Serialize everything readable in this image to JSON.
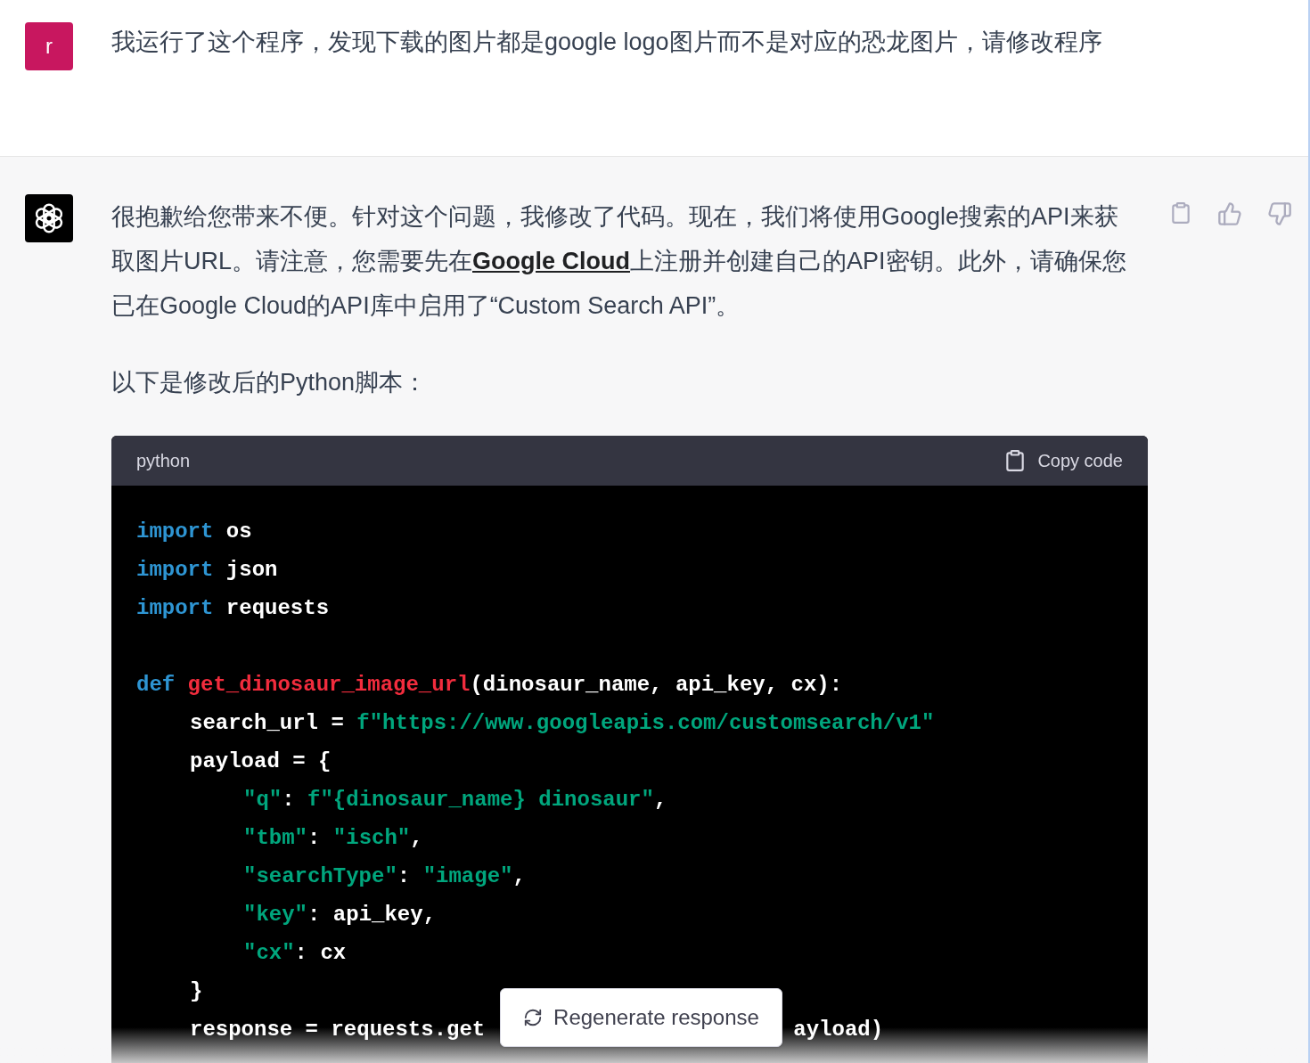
{
  "user_message": {
    "avatar": "r",
    "text": "我运行了这个程序，发现下载的图片都是google logo图片而不是对应的恐龙图片，请修改程序"
  },
  "assistant_message": {
    "paragraphs": [
      {
        "parts": [
          {
            "kind": "text",
            "text": "很抱歉给您带来不便。针对这个问题，我修改了代码。现在，我们将使用Google搜索的API来获取图片URL。请注意，您需要先在"
          },
          {
            "kind": "link",
            "text": "Google Cloud"
          },
          {
            "kind": "text",
            "text": "上注册并创建自己的API密钥。此外，请确保您已在Google Cloud的API库中启用了“Custom Search API”。"
          }
        ]
      },
      {
        "parts": [
          {
            "kind": "text",
            "text": "以下是修改后的Python脚本："
          }
        ]
      }
    ],
    "code_block": {
      "language": "python",
      "copy_label": "Copy code",
      "lines": [
        {
          "segments": [
            [
              {
                "kind": "keyword",
                "text": "import"
              },
              {
                "kind": "plain",
                "text": " os"
              }
            ]
          ]
        },
        {
          "segments": [
            [
              {
                "kind": "keyword",
                "text": "import"
              },
              {
                "kind": "plain",
                "text": " json"
              }
            ]
          ]
        },
        {
          "segments": [
            [
              {
                "kind": "keyword",
                "text": "import"
              },
              {
                "kind": "plain",
                "text": " requests"
              }
            ]
          ]
        },
        {
          "blank_before": true,
          "segments": [
            [
              {
                "kind": "keyword",
                "text": "def "
              },
              {
                "kind": "function",
                "text": "get_dinosaur_image_url"
              },
              {
                "kind": "plain",
                "text": "(dinosaur_name, api_key, cx):"
              }
            ]
          ],
          "children": [
            {
              "segments": [
                [
                  {
                    "kind": "plain",
                    "text": "search_url = "
                  },
                  {
                    "kind": "string",
                    "text": "f\"https://www.googleapis.com/customsearch/v1\""
                  }
                ]
              ]
            },
            {
              "segments": [
                [
                  {
                    "kind": "plain",
                    "text": "payload = {"
                  }
                ]
              ],
              "children": [
                {
                  "segments": [
                    [
                      {
                        "kind": "string",
                        "text": "\"q\""
                      },
                      {
                        "kind": "plain",
                        "text": ": "
                      },
                      {
                        "kind": "string",
                        "text": "f\"{dinosaur_name} dinosaur\""
                      },
                      {
                        "kind": "plain",
                        "text": ","
                      }
                    ]
                  ]
                },
                {
                  "segments": [
                    [
                      {
                        "kind": "string",
                        "text": "\"tbm\""
                      },
                      {
                        "kind": "plain",
                        "text": ": "
                      },
                      {
                        "kind": "string",
                        "text": "\"isch\""
                      },
                      {
                        "kind": "plain",
                        "text": ","
                      }
                    ]
                  ]
                },
                {
                  "segments": [
                    [
                      {
                        "kind": "string",
                        "text": "\"searchType\""
                      },
                      {
                        "kind": "plain",
                        "text": ": "
                      },
                      {
                        "kind": "string",
                        "text": "\"image\""
                      },
                      {
                        "kind": "plain",
                        "text": ","
                      }
                    ]
                  ]
                },
                {
                  "segments": [
                    [
                      {
                        "kind": "string",
                        "text": "\"key\""
                      },
                      {
                        "kind": "plain",
                        "text": ": api_key,"
                      }
                    ]
                  ]
                },
                {
                  "segments": [
                    [
                      {
                        "kind": "string",
                        "text": "\"cx\""
                      },
                      {
                        "kind": "plain",
                        "text": ": cx"
                      }
                    ]
                  ]
                }
              ]
            },
            {
              "segments": [
                [
                  {
                    "kind": "plain",
                    "text": "}"
                  }
                ]
              ]
            },
            {
              "segments": [
                [
                  {
                    "kind": "plain",
                    "text": "response = requests.get"
                  }
                ],
                [
                  {
                    "kind": "plain",
                    "text": "ayload)"
                  }
                ]
              ]
            }
          ]
        }
      ]
    }
  },
  "regenerate_button": {
    "label": "Regenerate response"
  }
}
